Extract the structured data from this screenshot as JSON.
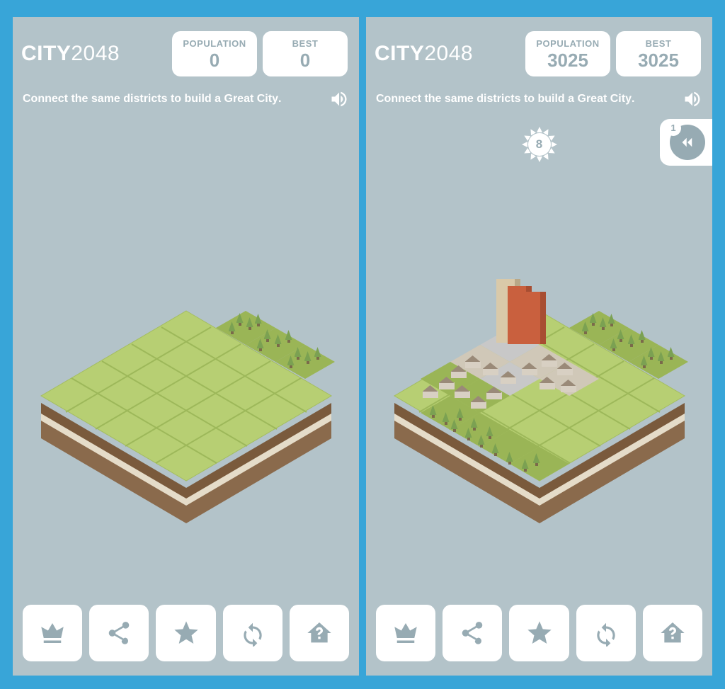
{
  "logo": {
    "bold": "CITY",
    "num": "2048"
  },
  "scores": {
    "popLabel": "POPULATION",
    "bestLabel": "BEST"
  },
  "tagline": {
    "pre": "Connect the same districts to build a ",
    "strong": "Great City",
    "post": "."
  },
  "left": {
    "population": "0",
    "best": "0"
  },
  "right": {
    "population": "3025",
    "best": "3025",
    "sunValue": "8",
    "undoCount": "1"
  },
  "bottomButtons": [
    "leaderboard",
    "share",
    "rate",
    "restart",
    "help"
  ]
}
